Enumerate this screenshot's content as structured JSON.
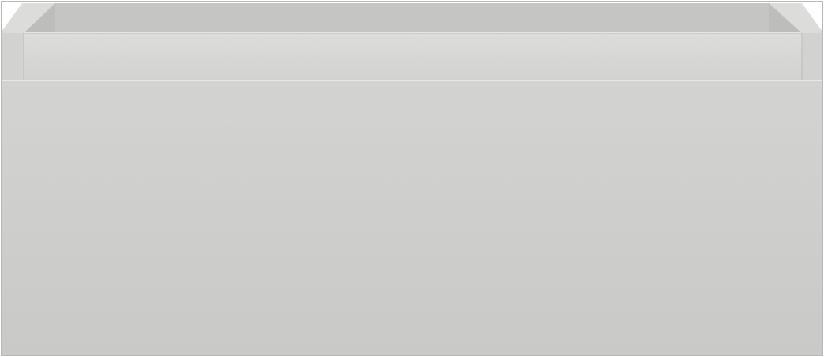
{
  "image": {
    "subject": "",
    "colors": {
      "background": "#ffffff",
      "front_panel_top": "#d3d3d2",
      "front_panel_bottom": "#c9c9c8",
      "rim_top": "#dcdcdb",
      "rim_front": "#d2d2d1",
      "inner_back_wall": "#c5c5c4",
      "inner_side_wall": "#bdbdbc",
      "edge_highlight": "#e8e8e7",
      "edge_shadow": "#a9a9a8",
      "outline": "#b8b8b7"
    }
  }
}
